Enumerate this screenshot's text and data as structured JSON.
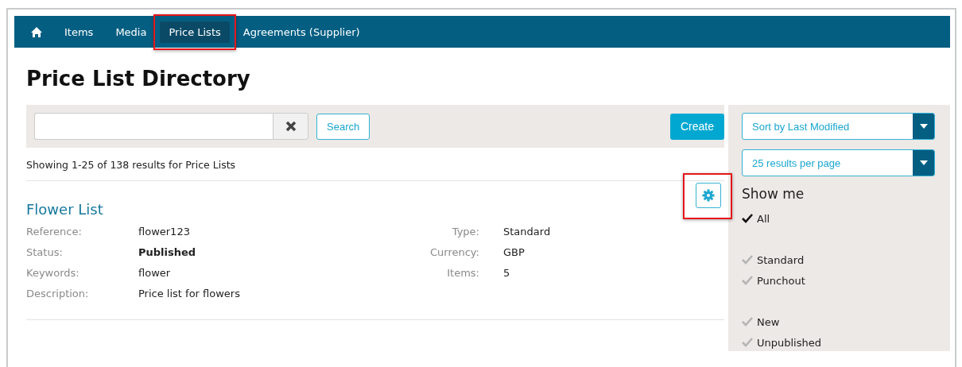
{
  "nav": {
    "items": [
      {
        "kind": "text",
        "label": "Items",
        "selected": false,
        "highlighted": false
      },
      {
        "kind": "text",
        "label": "Media",
        "selected": false,
        "highlighted": false
      },
      {
        "kind": "text",
        "label": "Price Lists",
        "selected": true,
        "highlighted": true
      },
      {
        "kind": "text",
        "label": "Agreements (Supplier)",
        "selected": false,
        "highlighted": false
      }
    ]
  },
  "page_title": "Price List Directory",
  "search": {
    "button": "Search"
  },
  "create_button": "Create",
  "sort_dropdown": "Sort by Last Modified",
  "per_page_dropdown": "25 results per page",
  "results_summary": "Showing 1-25 of 138 results for Price Lists",
  "results": [
    {
      "title": "Flower List",
      "settings_highlighted": true,
      "left_fields": [
        {
          "label": "Reference:",
          "value": "flower123",
          "bold": false
        },
        {
          "label": "Status:",
          "value": "Published",
          "bold": true
        },
        {
          "label": "Keywords:",
          "value": "flower",
          "bold": false
        },
        {
          "label": "Description:",
          "value": "Price list for flowers",
          "bold": false
        }
      ],
      "right_fields": [
        {
          "label": "Type:",
          "value": "Standard"
        },
        {
          "label": "Currency:",
          "value": "GBP"
        },
        {
          "label": "Items:",
          "value": "5"
        }
      ]
    }
  ],
  "filters": {
    "title": "Show me",
    "groups": [
      [
        {
          "label": "All",
          "checked": true
        }
      ],
      [
        {
          "label": "Standard",
          "checked": false
        },
        {
          "label": "Punchout",
          "checked": false
        }
      ],
      [
        {
          "label": "New",
          "checked": false
        },
        {
          "label": "Unpublished",
          "checked": false
        }
      ]
    ]
  }
}
